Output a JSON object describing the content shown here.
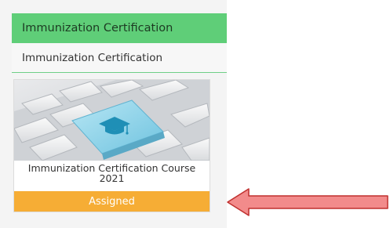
{
  "header": {
    "title": "Immunization Certification"
  },
  "section": {
    "label": "Immunization Certification"
  },
  "course_card": {
    "title_line1": "Immunization Certification Course",
    "title_line2": "2021",
    "status": "Assigned",
    "image_icon": "graduation-cap-icon"
  },
  "colors": {
    "header_green": "#5fce78",
    "status_orange": "#f6ad35",
    "arrow_fill": "#f28b8b",
    "arrow_stroke": "#c0302e",
    "key_blue": "#8ed3ea"
  }
}
